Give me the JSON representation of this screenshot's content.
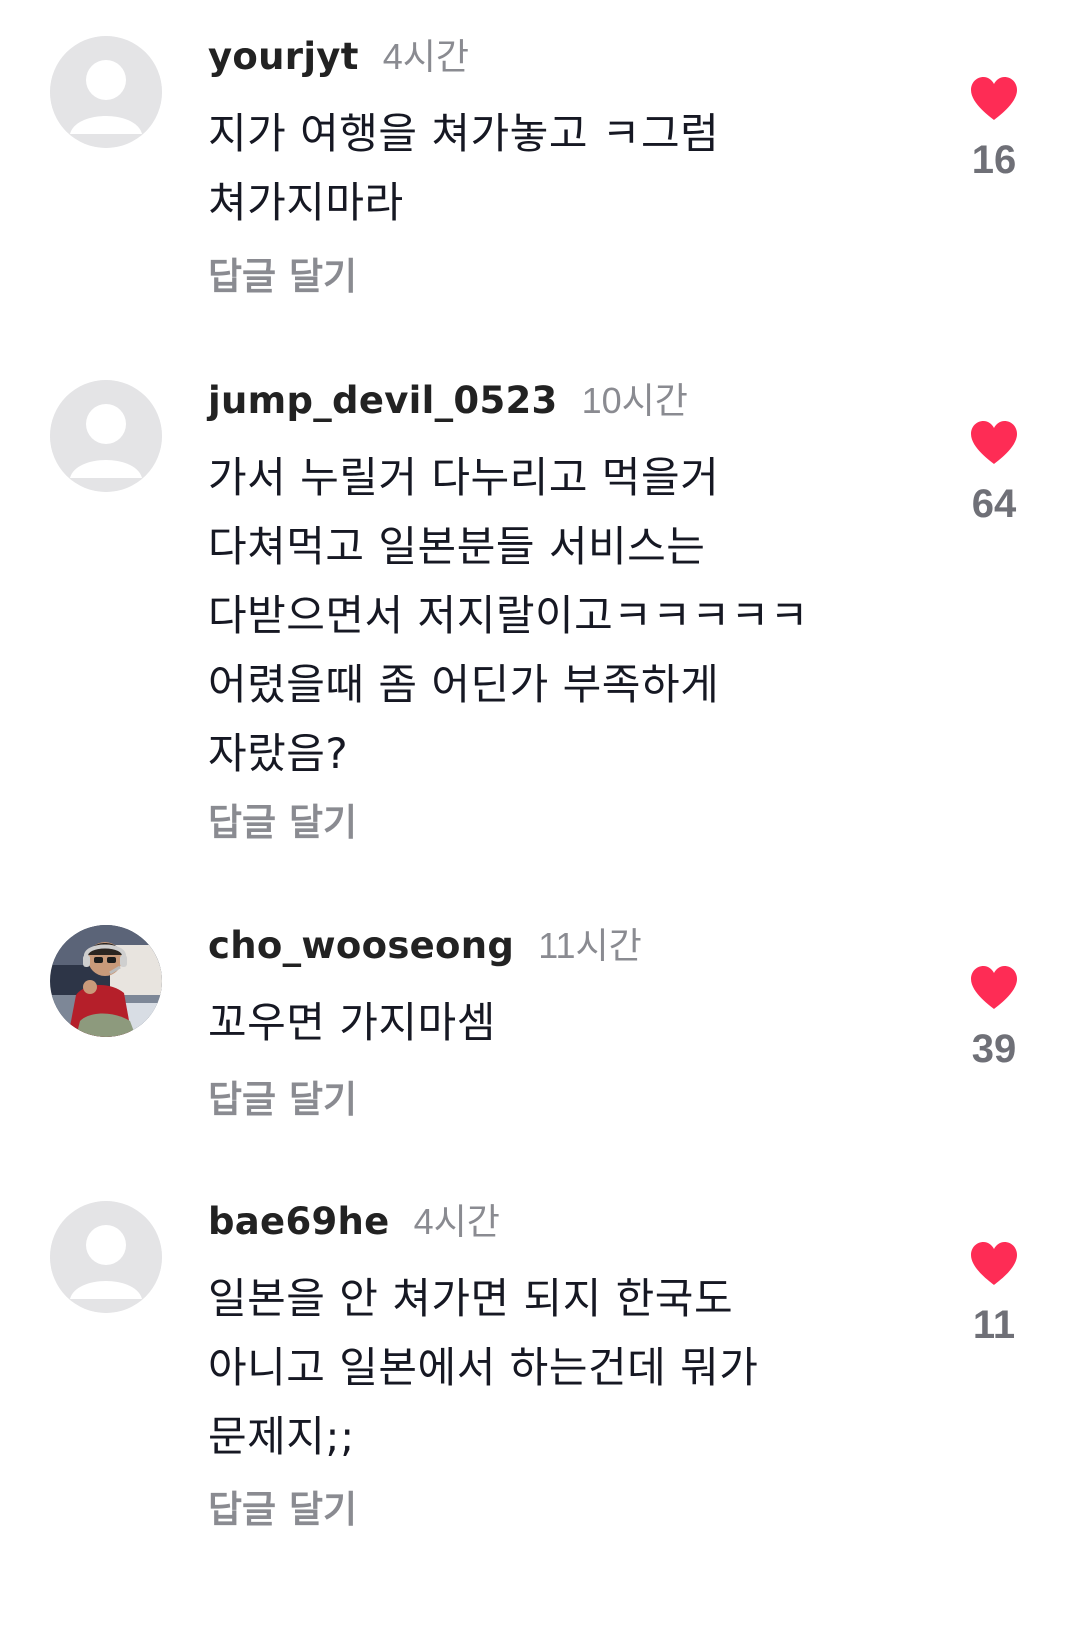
{
  "accent_colors": {
    "like_heart": "#fe2c55",
    "secondary_text": "#8a8b91",
    "primary_text": "#161823"
  },
  "comments": [
    {
      "username": "yourjyt",
      "time": "4시간",
      "lines": [
        "지가 여행을 쳐가놓고 ㅋ그럼",
        "쳐가지마라"
      ],
      "reply_label": "답글 달기",
      "likes": "16",
      "avatar": "default-avatar"
    },
    {
      "username": "jump_devil_0523",
      "time": "10시간",
      "lines": [
        "가서 누릴거 다누리고 먹을거",
        "다쳐먹고 일본분들 서비스는",
        "다받으면서 저지랄이고ㅋㅋㅋㅋㅋ",
        "어렸을때 좀 어딘가 부족하게",
        "자랐음?"
      ],
      "reply_label": "답글 달기",
      "likes": "64",
      "avatar": "default-avatar"
    },
    {
      "username": "cho_wooseong",
      "time": "11시간",
      "lines": [
        "꼬우면 가지마셈"
      ],
      "reply_label": "답글 달기",
      "likes": "39",
      "avatar": "photo-avatar"
    },
    {
      "username": "bae69he",
      "time": "4시간",
      "lines": [
        "일본을 안 쳐가면 되지 한국도",
        "아니고 일본에서 하는건데 뭐가",
        "문제지;;"
      ],
      "reply_label": "답글 달기",
      "likes": "11",
      "avatar": "default-avatar"
    }
  ]
}
